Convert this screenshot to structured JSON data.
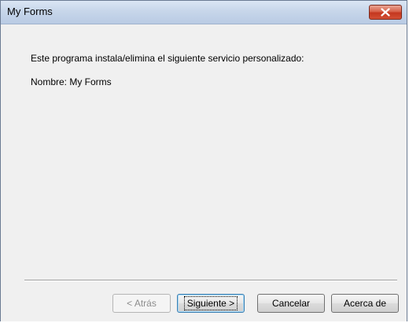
{
  "window": {
    "title": "My Forms"
  },
  "main": {
    "description": "Este programa instala/elimina el siguiente servicio personalizado:",
    "name_line": "Nombre: My Forms"
  },
  "buttons": {
    "back": {
      "label": "< Atrás",
      "enabled": false
    },
    "next": {
      "label": "Siguiente >",
      "enabled": true,
      "default": true
    },
    "cancel": {
      "label": "Cancelar",
      "enabled": true
    },
    "about": {
      "label": "Acerca de",
      "enabled": true
    }
  },
  "icons": {
    "close": "close-icon"
  },
  "colors": {
    "close_button": "#c4371f",
    "titlebar": "#c7d6ea",
    "dialog_background": "#f0f0f0"
  }
}
